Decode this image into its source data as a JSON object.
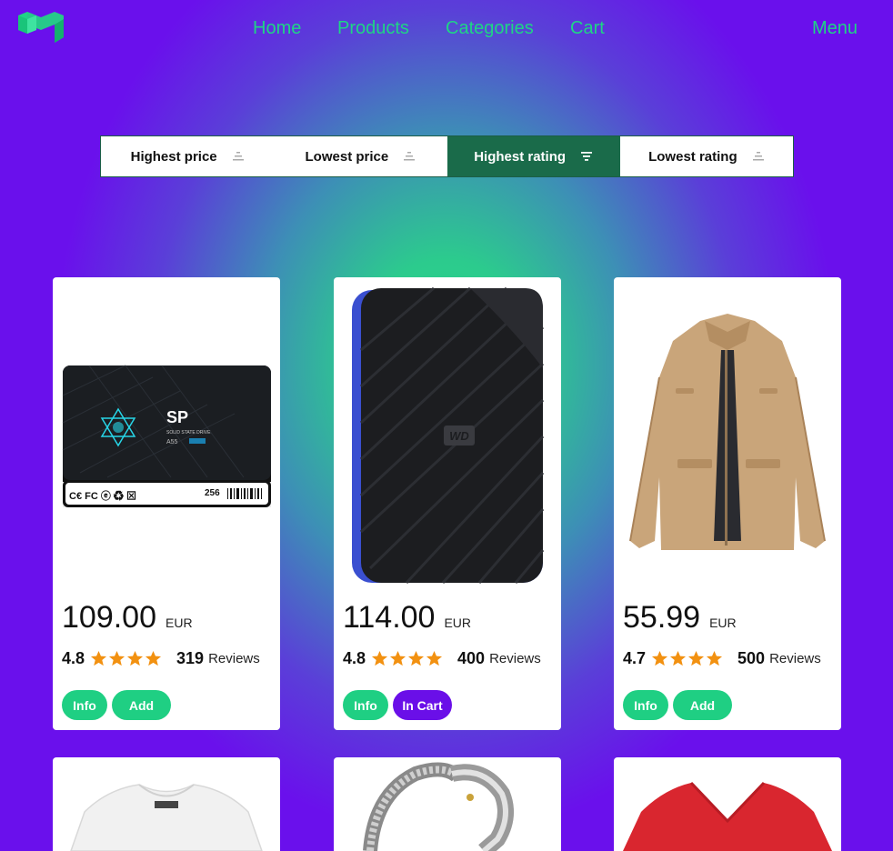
{
  "header": {
    "logo_icon": "cube-logo-icon",
    "nav": [
      {
        "label": "Home"
      },
      {
        "label": "Products"
      },
      {
        "label": "Categories"
      },
      {
        "label": "Cart"
      }
    ],
    "menu_label": "Menu"
  },
  "sort": {
    "options": [
      {
        "label": "Highest price",
        "active": false
      },
      {
        "label": "Lowest price",
        "active": false
      },
      {
        "label": "Highest rating",
        "active": true
      },
      {
        "label": "Lowest rating",
        "active": false
      }
    ]
  },
  "colors": {
    "accent_green": "#1fcf83",
    "active_sort": "#1a6b4a",
    "purple": "#6a0fe8",
    "star": "#f29111"
  },
  "products": [
    {
      "image_icon": "ssd-drive-image",
      "price": "109.00",
      "currency": "EUR",
      "rating": "4.8",
      "reviews_count": "319",
      "reviews_label": "Reviews",
      "info_label": "Info",
      "cart_label": "Add",
      "in_cart": false
    },
    {
      "image_icon": "external-hard-drive-image",
      "price": "114.00",
      "currency": "EUR",
      "rating": "4.8",
      "reviews_count": "400",
      "reviews_label": "Reviews",
      "info_label": "Info",
      "cart_label": "In Cart",
      "in_cart": true
    },
    {
      "image_icon": "khaki-jacket-image",
      "price": "55.99",
      "currency": "EUR",
      "rating": "4.7",
      "reviews_count": "500",
      "reviews_label": "Reviews",
      "info_label": "Info",
      "cart_label": "Add",
      "in_cart": false
    },
    {
      "image_icon": "white-top-image"
    },
    {
      "image_icon": "silver-dragon-bracelet-image"
    },
    {
      "image_icon": "red-vneck-shirt-image"
    }
  ]
}
